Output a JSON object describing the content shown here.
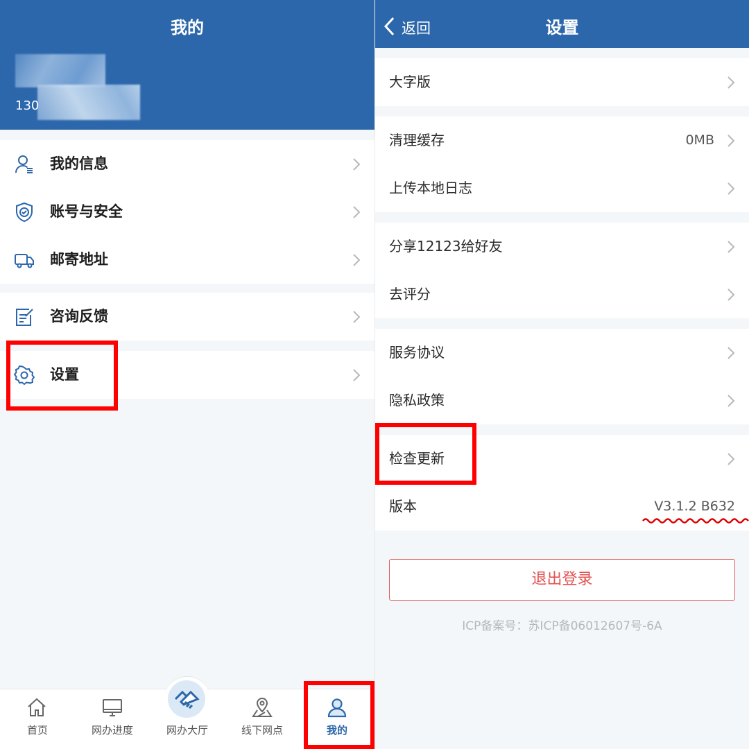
{
  "left": {
    "header": {
      "title": "我的"
    },
    "profile": {
      "phone_prefix": "130"
    },
    "groups": [
      [
        {
          "label": "我的信息",
          "icon": "user-icon"
        },
        {
          "label": "账号与安全",
          "icon": "shield-icon"
        },
        {
          "label": "邮寄地址",
          "icon": "truck-icon"
        }
      ],
      [
        {
          "label": "咨询反馈",
          "icon": "edit-icon"
        }
      ],
      [
        {
          "label": "设置",
          "icon": "gear-icon"
        }
      ]
    ],
    "tabs": [
      {
        "label": "首页",
        "icon": "home-icon"
      },
      {
        "label": "网办进度",
        "icon": "monitor-icon"
      },
      {
        "label": "网办大厅",
        "icon": "handshake-icon"
      },
      {
        "label": "线下网点",
        "icon": "map-pin-icon"
      },
      {
        "label": "我的",
        "icon": "person-icon",
        "active": true
      }
    ]
  },
  "right": {
    "header": {
      "title": "设置",
      "back_label": "返回"
    },
    "groups": [
      [
        {
          "label": "大字版"
        }
      ],
      [
        {
          "label": "清理缓存",
          "value": "0MB"
        },
        {
          "label": "上传本地日志"
        }
      ],
      [
        {
          "label": "分享12123给好友"
        },
        {
          "label": "去评分"
        }
      ],
      [
        {
          "label": "服务协议"
        },
        {
          "label": "隐私政策"
        }
      ],
      [
        {
          "label": "检查更新"
        },
        {
          "label": "版本",
          "value": "V3.1.2 B632"
        }
      ]
    ],
    "logout_label": "退出登录",
    "icp_text": "ICP备案号：苏ICP备06012607号-6A"
  },
  "colors": {
    "brand": "#2c67ab",
    "highlight": "#ff0000",
    "danger": "#e25353"
  }
}
